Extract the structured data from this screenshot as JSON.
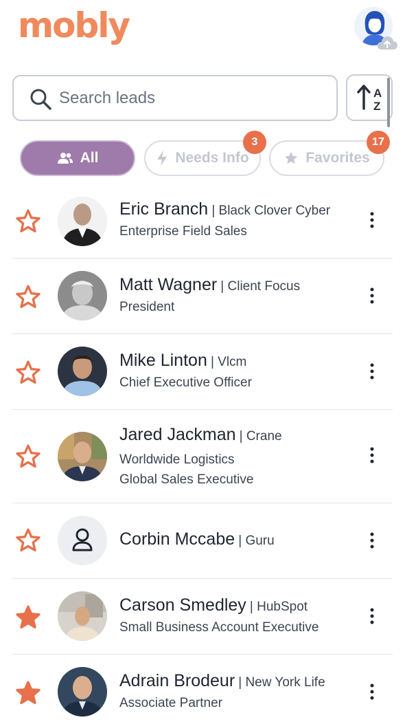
{
  "app": {
    "logo_text": "mobly"
  },
  "search": {
    "placeholder": "Search leads"
  },
  "filters": {
    "all_label": "All",
    "needs_info_label": "Needs Info",
    "needs_info_count": "3",
    "favorites_label": "Favorites",
    "favorites_count": "17"
  },
  "leads": [
    {
      "name": "Eric Branch",
      "company": "| Black Clover Cyber",
      "title_lines": [
        "Enterprise Field Sales"
      ],
      "favorite": false,
      "avatar": "photo"
    },
    {
      "name": "Matt Wagner",
      "company": "| Client Focus",
      "title_lines": [
        "President"
      ],
      "favorite": false,
      "avatar": "photo"
    },
    {
      "name": "Mike Linton",
      "company": "| Vlcm",
      "title_lines": [
        "Chief Executive Officer"
      ],
      "favorite": false,
      "avatar": "photo"
    },
    {
      "name": "Jared Jackman",
      "company": "| Crane",
      "title_lines": [
        "Worldwide Logistics",
        "Global Sales Executive"
      ],
      "favorite": false,
      "avatar": "photo"
    },
    {
      "name": "Corbin Mccabe",
      "company": "| Guru",
      "title_lines": [],
      "favorite": false,
      "avatar": "placeholder"
    },
    {
      "name": "Carson Smedley",
      "company": "| HubSpot",
      "title_lines": [
        "Small Business Account Executive"
      ],
      "favorite": true,
      "avatar": "photo"
    },
    {
      "name": "Adrain Brodeur",
      "company": "| New York Life",
      "title_lines": [
        "Associate Partner"
      ],
      "favorite": true,
      "avatar": "photo"
    }
  ],
  "colors": {
    "accent": "#e8704a",
    "chip_active": "#9e7bab",
    "text": "#1f2430",
    "muted": "#c3c7cf"
  },
  "icons": [
    "search-icon",
    "sort-alpha-icon",
    "users-icon",
    "bolt-icon",
    "star-icon",
    "kebab-menu-icon",
    "user-outline-icon",
    "cloud-upload-icon"
  ]
}
